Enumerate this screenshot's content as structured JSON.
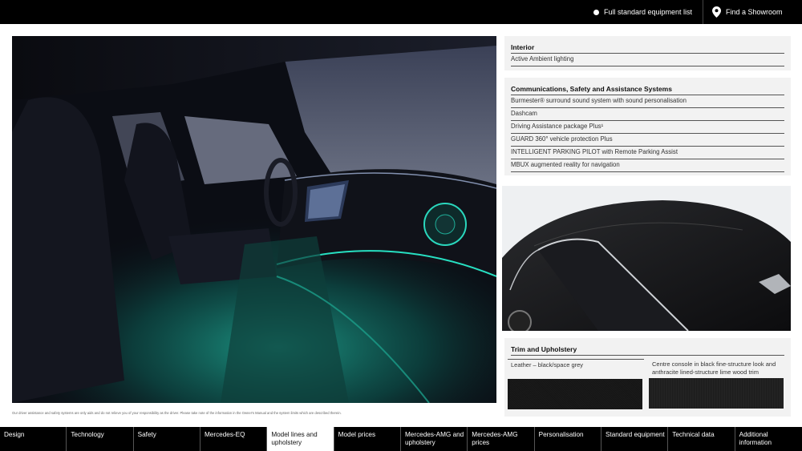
{
  "topbar": {
    "equipment_link": "Full standard equipment list",
    "showroom_link": "Find a Showroom"
  },
  "disclaimer": "Our driver assistance and safety systems are only aids and do not relieve you of your responsibility as the driver. Please take note of the information in the Owner's Manual and the system limits which are described therein.",
  "interior": {
    "heading": "Interior",
    "items": [
      "Active Ambient lighting"
    ]
  },
  "comms": {
    "heading": "Communications, Safety and Assistance Systems",
    "items": [
      "Burmester® surround sound system with sound personalisation",
      "Dashcam",
      "Driving Assistance package Plus¹",
      "GUARD 360° vehicle protection Plus",
      "INTELLIGENT PARKING PILOT with Remote Parking Assist",
      "MBUX augmented reality for navigation"
    ]
  },
  "trim": {
    "heading": "Trim and Upholstery",
    "options": [
      "Leather – black/space grey",
      "Centre console in black fine-structure look and anthracite lined-structure lime wood trim"
    ]
  },
  "nav": {
    "tabs": [
      "Design",
      "Technology",
      "Safety",
      "Mercedes-EQ",
      "Model lines and upholstery",
      "Model prices",
      "Mercedes-AMG and upholstery",
      "Mercedes-AMG prices",
      "Personalisation",
      "Standard equipment",
      "Technical data",
      "Additional information"
    ],
    "active_index": 4
  },
  "colors": {
    "bar_background": "#000000",
    "panel_background": "#f2f2f2",
    "ambient_light": "#1ed6b8"
  }
}
